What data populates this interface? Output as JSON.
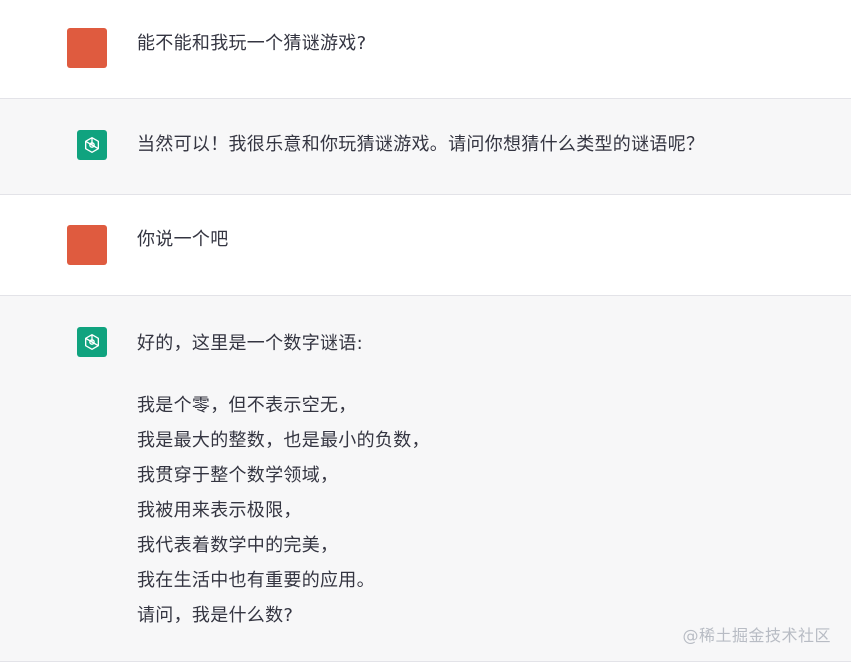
{
  "messages": [
    {
      "role": "user",
      "text": "能不能和我玩一个猜谜游戏?"
    },
    {
      "role": "assistant",
      "text": "当然可以！我很乐意和你玩猜谜游戏。请问你想猜什么类型的谜语呢？"
    },
    {
      "role": "user",
      "text": "你说一个吧"
    },
    {
      "role": "assistant",
      "intro": "好的，这里是一个数字谜语:",
      "lines": [
        "我是个零，但不表示空无，",
        "我是最大的整数，也是最小的负数，",
        "我贯穿于整个数学领域，",
        "我被用来表示极限，",
        "我代表着数学中的完美，",
        "我在生活中也有重要的应用。",
        "请问，我是什么数?"
      ]
    }
  ],
  "watermark": "@稀土掘金技术社区",
  "colors": {
    "user_avatar": "#df5b3f",
    "bot_avatar": "#10a37f",
    "assistant_bg": "#f7f7f8"
  },
  "icons": {
    "user_avatar": "user-avatar-icon",
    "bot_avatar": "openai-logo-icon"
  }
}
